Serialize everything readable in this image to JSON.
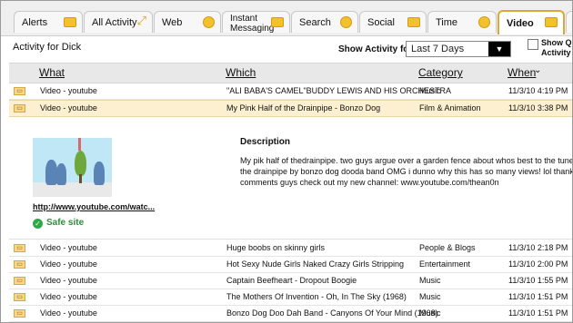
{
  "tabs": [
    {
      "label": "Alerts",
      "icon": "alert-icon"
    },
    {
      "label": "All Activity",
      "icon": "link-icon"
    },
    {
      "label": "Web",
      "icon": "globe-icon"
    },
    {
      "label": "Instant Messaging",
      "label_line1": "Instant",
      "label_line2": "Messaging",
      "icon": "chat-icon"
    },
    {
      "label": "Search",
      "icon": "magnifier-icon"
    },
    {
      "label": "Social",
      "icon": "people-icon"
    },
    {
      "label": "Time",
      "icon": "clock-icon"
    },
    {
      "label": "Video",
      "icon": "video-icon",
      "active": true
    }
  ],
  "header": {
    "title": "Activity for Dick",
    "show_label": "Show Activity for",
    "period": "Last 7 Days",
    "checkbox_line1": "Show Qu",
    "checkbox_line2": "Activity C"
  },
  "columns": {
    "what": "What",
    "which": "Which",
    "category": "Category",
    "when": "When"
  },
  "rows_top": [
    {
      "what": "Video - youtube",
      "which": "\"ALI BABA'S CAMEL\"BUDDY LEWIS AND HIS ORCHESTRA",
      "category": "Music",
      "when": "11/3/10 4:19 PM"
    },
    {
      "what": "Video - youtube",
      "which": "My Pink Half of the Drainpipe - Bonzo Dog",
      "category": "Film & Animation",
      "when": "11/3/10 3:38 PM",
      "selected": true
    }
  ],
  "detail": {
    "url": "http://www.youtube.com/watc...",
    "safe_label": "Safe site",
    "description_heading": "Description",
    "description_lines": [
      "My pik half of thedrainpipe. two guys argue over a garden fence about whos best to the tune o",
      "the drainpipe by bonzo dog dooda band OMG i dunno why this has so many views! lol thanks t",
      "comments guys check out my new channel: www.youtube.com/thean0n"
    ]
  },
  "rows_bottom": [
    {
      "what": "Video - youtube",
      "which": "Huge boobs on skinny girls",
      "category": "People & Blogs",
      "when": "11/3/10 2:18 PM"
    },
    {
      "what": "Video - youtube",
      "which": "Hot Sexy Nude Girls Naked Crazy Girls Stripping",
      "category": "Entertainment",
      "when": "11/3/10 2:00 PM"
    },
    {
      "what": "Video - youtube",
      "which": "Captain Beefheart - Dropout Boogie",
      "category": "Music",
      "when": "11/3/10 1:55 PM"
    },
    {
      "what": "Video - youtube",
      "which": "The Mothers Of Invention - Oh, In The Sky (1968)",
      "category": "Music",
      "when": "11/3/10 1:51 PM"
    },
    {
      "what": "Video - youtube",
      "which": "Bonzo Dog Doo Dah Band - Canyons Of Your Mind (1968)",
      "category": "Music",
      "when": "11/3/10 1:51 PM"
    }
  ]
}
